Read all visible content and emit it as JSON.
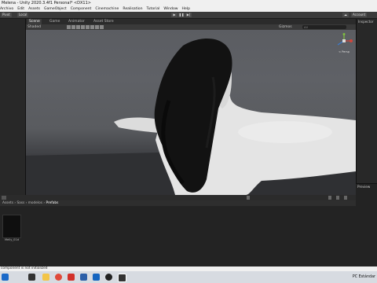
{
  "window": {
    "title": "Melena - Unity 2020.3.4f1 Personal* <DX11>"
  },
  "menu": [
    "Archivo",
    "Edit",
    "Assets",
    "GameObject",
    "Component",
    "Cinemachine",
    "Realisation",
    "Tutorial",
    "Window",
    "Help"
  ],
  "toolbar": {
    "pivot_label": "Pivot",
    "local_label": "Local",
    "account_label": "Account"
  },
  "tabs": [
    "Scene",
    "Game",
    "Animator",
    "Asset Store"
  ],
  "scene_toolbar": {
    "shading_mode": "Shaded",
    "gizmos_label": "Gizmos",
    "search_placeholder": "All"
  },
  "gizmo": {
    "view_label": "< Persp"
  },
  "project": {
    "breadcrumb": [
      "Assets",
      "Sass",
      "modelos",
      "Prefabs"
    ],
    "asset_name": "Melly_01d"
  },
  "inspector": {
    "title": "Inspector"
  },
  "preview": {
    "title": "Preview"
  },
  "status": {
    "message": "component is not initialized"
  },
  "tray": {
    "language": "ESP",
    "region": "PC",
    "time": "Estándar"
  },
  "colors": {
    "viewport_top": "#5b5d62",
    "skin": "#e6e6e6",
    "hair": "#121212",
    "accent_red": "#c0392b"
  }
}
